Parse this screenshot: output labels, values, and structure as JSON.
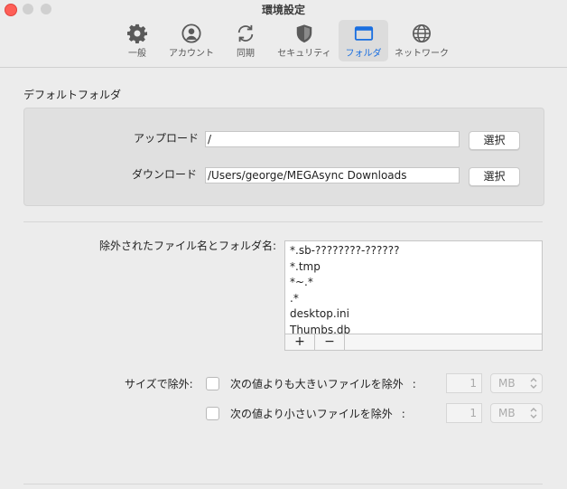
{
  "window": {
    "title": "環境設定"
  },
  "tabs": [
    {
      "label": "一般",
      "icon": "gear-icon"
    },
    {
      "label": "アカウント",
      "icon": "account-icon"
    },
    {
      "label": "同期",
      "icon": "sync-icon"
    },
    {
      "label": "セキュリティ",
      "icon": "shield-icon"
    },
    {
      "label": "フォルダ",
      "icon": "folder-icon",
      "active": true
    },
    {
      "label": "ネットワーク",
      "icon": "globe-icon"
    }
  ],
  "colors": {
    "accent": "#1a6fe0",
    "close": "#fe5f57"
  },
  "folders": {
    "section_title": "デフォルトフォルダ",
    "upload_label": "アップロード",
    "upload_value": "/",
    "download_label": "ダウンロード",
    "download_value": "/Users/george/MEGAsync Downloads",
    "select_label": "選択"
  },
  "excluded": {
    "label": "除外されたファイル名とフォルダ名:",
    "items": [
      "*.sb-????????-??????",
      "*.tmp",
      "*~.*",
      ".*",
      "desktop.ini",
      "Thumbs.db"
    ],
    "add_label": "+",
    "remove_label": "−"
  },
  "size": {
    "label": "サイズで除外:",
    "larger_label": "次の値よりも大きいファイルを除外",
    "smaller_label": "次の値より小さいファイルを除外",
    "colon": ":",
    "larger_value": "1",
    "smaller_value": "1",
    "larger_unit": "MB",
    "smaller_unit": "MB"
  }
}
